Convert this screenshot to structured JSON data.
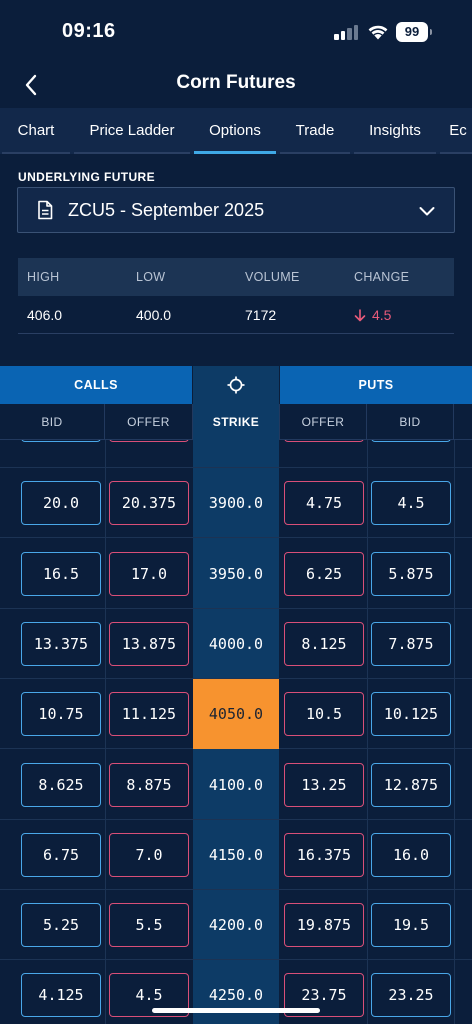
{
  "status": {
    "time": "09:16",
    "battery": "99"
  },
  "nav": {
    "title": "Corn Futures"
  },
  "tabs": [
    {
      "label": "Chart",
      "width": 72
    },
    {
      "label": "Price Ladder",
      "width": 120
    },
    {
      "label": "Options",
      "width": 86
    },
    {
      "label": "Trade",
      "width": 74
    },
    {
      "label": "Insights",
      "width": 86
    },
    {
      "label": "Ec",
      "width": 40
    }
  ],
  "active_tab": "Options",
  "underlying": {
    "label": "UNDERLYING FUTURE",
    "value": "ZCU5 - September 2025"
  },
  "stats": {
    "headers": [
      "HIGH",
      "LOW",
      "VOLUME",
      "CHANGE"
    ],
    "high": "406.0",
    "low": "400.0",
    "volume": "7172",
    "change": "4.5",
    "change_direction": "down"
  },
  "board": {
    "calls_label": "CALLS",
    "puts_label": "PUTS",
    "columns": [
      "BID",
      "OFFER",
      "STRIKE",
      "OFFER",
      "BID"
    ],
    "rows": [
      {
        "call_bid": "",
        "call_offer": "",
        "strike": "",
        "put_offer": "",
        "put_bid": "",
        "partial": true
      },
      {
        "call_bid": "20.0",
        "call_offer": "20.375",
        "strike": "3900.0",
        "put_offer": "4.75",
        "put_bid": "4.5"
      },
      {
        "call_bid": "16.5",
        "call_offer": "17.0",
        "strike": "3950.0",
        "put_offer": "6.25",
        "put_bid": "5.875"
      },
      {
        "call_bid": "13.375",
        "call_offer": "13.875",
        "strike": "4000.0",
        "put_offer": "8.125",
        "put_bid": "7.875"
      },
      {
        "call_bid": "10.75",
        "call_offer": "11.125",
        "strike": "4050.0",
        "put_offer": "10.5",
        "put_bid": "10.125",
        "at_the_money": true
      },
      {
        "call_bid": "8.625",
        "call_offer": "8.875",
        "strike": "4100.0",
        "put_offer": "13.25",
        "put_bid": "12.875"
      },
      {
        "call_bid": "6.75",
        "call_offer": "7.0",
        "strike": "4150.0",
        "put_offer": "16.375",
        "put_bid": "16.0"
      },
      {
        "call_bid": "5.25",
        "call_offer": "5.5",
        "strike": "4200.0",
        "put_offer": "19.875",
        "put_bid": "19.5"
      },
      {
        "call_bid": "4.125",
        "call_offer": "4.5",
        "strike": "4250.0",
        "put_offer": "23.75",
        "put_bid": "23.25"
      }
    ]
  },
  "colors": {
    "background": "#0b1e3b",
    "accent": "#3fa9e6",
    "calls_puts_header": "#0a64b3",
    "strike_column": "#0d3b66",
    "at_the_money": "#f7932f",
    "bid_border": "#4aa7e8",
    "offer_border": "#d94f78",
    "negative": "#e85a7a"
  },
  "icons": [
    "back-chevron-icon",
    "document-icon",
    "chevron-down-icon",
    "crosshair-icon",
    "arrow-down-icon",
    "signal-icon",
    "wifi-icon",
    "battery-icon"
  ]
}
